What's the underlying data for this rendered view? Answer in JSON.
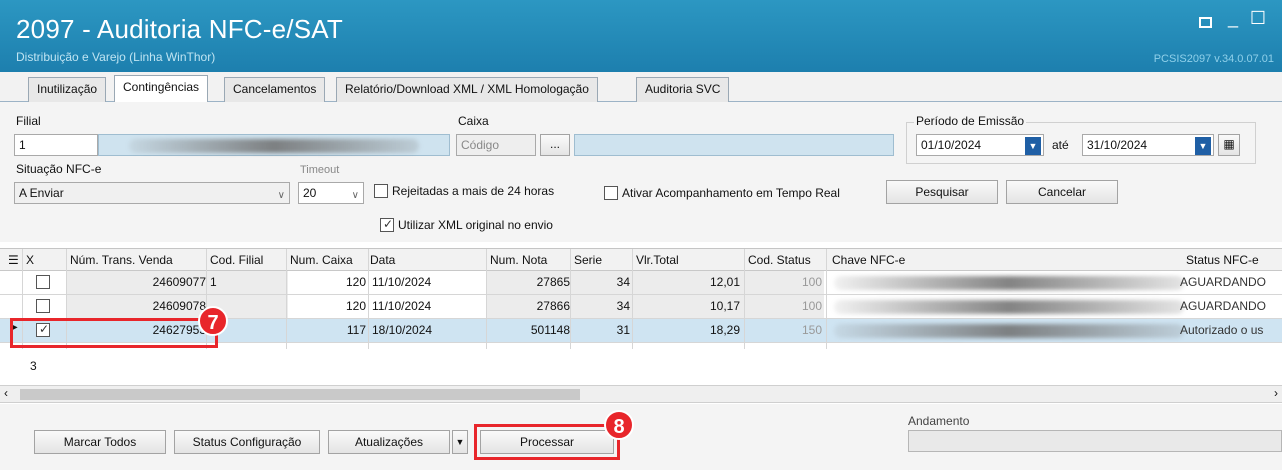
{
  "window": {
    "title": "2097 - Auditoria NFC-e/SAT",
    "subtitle": "Distribuição e Varejo (Linha WinThor)",
    "version": "PCSIS2097 v.34.0.07.01"
  },
  "tabs": [
    {
      "label": "Inutilização"
    },
    {
      "label": "Contingências",
      "active": true
    },
    {
      "label": "Cancelamentos"
    },
    {
      "label": "Relatório/Download XML / XML Homologação"
    },
    {
      "label": "Auditoria SVC"
    }
  ],
  "form": {
    "filial_label": "Filial",
    "filial_value": "1",
    "caixa_label": "Caixa",
    "caixa_placeholder": "Código",
    "ellipsis": "...",
    "periodo_label": "Período de Emissão",
    "date_from": "01/10/2024",
    "ate_label": "até",
    "date_to": "31/10/2024",
    "situacao_label": "Situação NFC-e",
    "situacao_value": "A Enviar",
    "timeout_label": "Timeout",
    "timeout_value": "20",
    "rejeitadas_label": "Rejeitadas a mais de 24 horas",
    "rejeitadas_checked": false,
    "acompanhamento_label": "Ativar Acompanhamento em Tempo Real",
    "acompanhamento_checked": false,
    "xml_original_label": "Utilizar XML original no envio",
    "xml_original_checked": true,
    "pesquisar_label": "Pesquisar",
    "cancelar_label": "Cancelar"
  },
  "grid": {
    "columns": [
      "X",
      "Núm. Trans. Venda",
      "Cod. Filial",
      "Num. Caixa",
      "Data",
      "Num. Nota",
      "Serie",
      "Vlr.Total",
      "Cod. Status",
      "Chave NFC-e",
      "Status NFC-e"
    ],
    "rows": [
      {
        "checked": false,
        "trans": "24609077",
        "filial": "1",
        "caixa": "120",
        "data": "11/10/2024",
        "nota": "27865",
        "serie": "34",
        "total": "12,01",
        "status_code": "100",
        "status": "AGUARDANDO"
      },
      {
        "checked": false,
        "trans": "24609078",
        "filial": "",
        "caixa": "120",
        "data": "11/10/2024",
        "nota": "27866",
        "serie": "34",
        "total": "10,17",
        "status_code": "100",
        "status": "AGUARDANDO"
      },
      {
        "checked": true,
        "trans": "24627953",
        "filial": "",
        "caixa": "117",
        "data": "18/10/2024",
        "nota": "501148",
        "serie": "31",
        "total": "18,29",
        "status_code": "150",
        "status": "Autorizado o us",
        "selected": true
      }
    ],
    "row_count": "3"
  },
  "bottom": {
    "marcar_todos": "Marcar Todos",
    "status_configuracao": "Status Configuração",
    "atualizacoes": "Atualizações",
    "processar": "Processar",
    "andamento_label": "Andamento"
  },
  "callouts": {
    "step7": "7",
    "step8": "8"
  },
  "colors": {
    "title_bar": "#1d7fae",
    "highlight": "#e8262b",
    "selected_row": "#cfe4f2"
  }
}
